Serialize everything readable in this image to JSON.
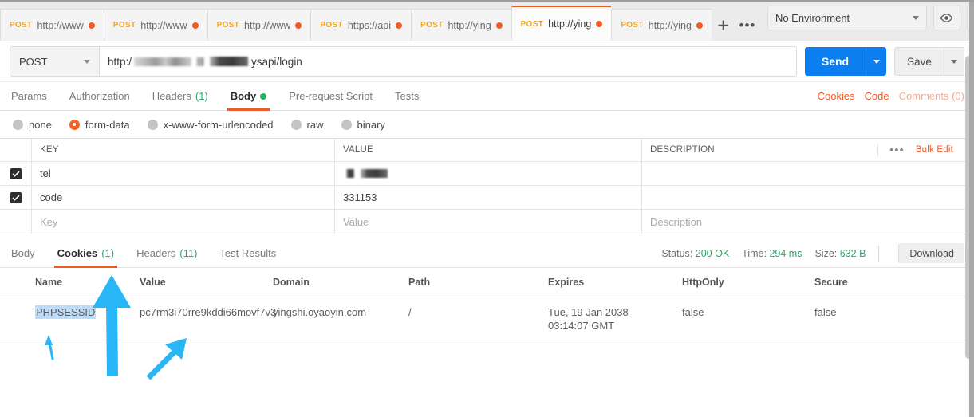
{
  "window": {
    "app": "Postman"
  },
  "tabstrip": {
    "tabs": [
      {
        "method": "POST",
        "label": "http://www",
        "unsaved": true,
        "active": false
      },
      {
        "method": "POST",
        "label": "http://www",
        "unsaved": true,
        "active": false
      },
      {
        "method": "POST",
        "label": "http://www",
        "unsaved": true,
        "active": false
      },
      {
        "method": "POST",
        "label": "https://api",
        "unsaved": true,
        "active": false
      },
      {
        "method": "POST",
        "label": "http://ying",
        "unsaved": true,
        "active": false
      },
      {
        "method": "POST",
        "label": "http://ying",
        "unsaved": true,
        "active": true
      },
      {
        "method": "POST",
        "label": "http://ying",
        "unsaved": true,
        "active": false
      }
    ],
    "new_tab_icon": "plus-icon",
    "more_icon": "ellipsis-icon",
    "environment": {
      "selected": "No Environment",
      "caret_icon": "chevron-down-icon"
    },
    "eye_icon": "eye-icon",
    "settings_icon": "gear-icon"
  },
  "request": {
    "method": "POST",
    "url_prefix": "http:/",
    "url_suffix": "ysapi/login",
    "send_label": "Send",
    "save_label": "Save",
    "tabs": [
      {
        "label": "Params",
        "count": "",
        "active": false,
        "dot": false
      },
      {
        "label": "Authorization",
        "count": "",
        "active": false,
        "dot": false
      },
      {
        "label": "Headers",
        "count": "(1)",
        "active": false,
        "dot": false
      },
      {
        "label": "Body",
        "count": "",
        "active": true,
        "dot": true
      },
      {
        "label": "Pre-request Script",
        "count": "",
        "active": false,
        "dot": false
      },
      {
        "label": "Tests",
        "count": "",
        "active": false,
        "dot": false
      }
    ],
    "links": {
      "cookies": "Cookies",
      "code": "Code",
      "comments": "Comments (0)"
    },
    "body_types": [
      {
        "label": "none",
        "selected": false
      },
      {
        "label": "form-data",
        "selected": true
      },
      {
        "label": "x-www-form-urlencoded",
        "selected": false
      },
      {
        "label": "raw",
        "selected": false
      },
      {
        "label": "binary",
        "selected": false
      }
    ],
    "kv_headers": {
      "key": "KEY",
      "value": "VALUE",
      "description": "DESCRIPTION",
      "bulk_edit": "Bulk Edit",
      "more_icon": "ellipsis-icon"
    },
    "kv_rows": [
      {
        "checked": true,
        "key": "tel",
        "value": "",
        "value_redacted": true,
        "description": ""
      },
      {
        "checked": true,
        "key": "code",
        "value": "331153",
        "value_redacted": false,
        "description": ""
      }
    ],
    "kv_placeholder": {
      "key": "Key",
      "value": "Value",
      "description": "Description"
    }
  },
  "response": {
    "tabs": [
      {
        "label": "Body",
        "count": "",
        "active": false
      },
      {
        "label": "Cookies",
        "count": "(1)",
        "active": true
      },
      {
        "label": "Headers",
        "count": "(11)",
        "active": false
      },
      {
        "label": "Test Results",
        "count": "",
        "active": false
      }
    ],
    "status_label": "Status:",
    "status_value": "200 OK",
    "time_label": "Time:",
    "time_value": "294 ms",
    "size_label": "Size:",
    "size_value": "632 B",
    "download_label": "Download",
    "cookie_headers": {
      "name": "Name",
      "value": "Value",
      "domain": "Domain",
      "path": "Path",
      "expires": "Expires",
      "httponly": "HttpOnly",
      "secure": "Secure"
    },
    "cookie_rows": [
      {
        "name": "PHPSESSID",
        "name_selected": true,
        "value": "pc7rm3i70rre9kddi66movf7v3",
        "domain": "yingshi.oyaoyin.com",
        "path": "/",
        "expires": "Tue, 19 Jan 2038 03:14:07 GMT",
        "httponly": "false",
        "secure": "false"
      }
    ]
  },
  "annotations": {
    "arrow_color": "#29b6f6",
    "items": [
      {
        "name": "arrow-to-cookie-name",
        "kind": "thin-arrow"
      },
      {
        "name": "arrow-to-cookies-tab",
        "kind": "thick-arrow"
      },
      {
        "name": "arrow-to-cookie-value",
        "kind": "medium-arrow"
      }
    ]
  },
  "colors": {
    "accent_orange": "#ef5b25",
    "send_blue": "#0d7ef0",
    "status_green": "#2aa86a",
    "method_amber": "#f5a623",
    "annotation_blue": "#29b6f6",
    "selection_blue": "#bfdcf7"
  }
}
